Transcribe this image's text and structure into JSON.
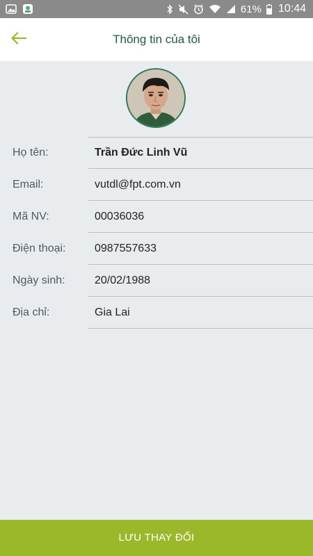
{
  "status_bar": {
    "battery_percent": "61%",
    "time": "10:44",
    "left_icons": [
      "gallery-notification-icon",
      "app-notification-icon"
    ],
    "right_icons": [
      "bluetooth-icon",
      "mute-icon",
      "alarm-icon",
      "wifi-icon",
      "signal-icon",
      "battery-icon"
    ]
  },
  "header": {
    "title": "Thông tin của tôi",
    "back_icon": "arrow-left-icon"
  },
  "profile": {
    "avatar_icon": "avatar"
  },
  "info": {
    "rows": [
      {
        "label": "Họ tên:",
        "value": "Trần Đức Linh Vũ"
      },
      {
        "label": "Email:",
        "value": "vutdl@fpt.com.vn"
      },
      {
        "label": "Mã NV:",
        "value": "00036036"
      },
      {
        "label": "Điện thoại:",
        "value": "0987557633"
      },
      {
        "label": "Ngày sinh:",
        "value": "20/02/1988"
      },
      {
        "label": "Địa chỉ:",
        "value": "Gia Lai"
      }
    ]
  },
  "footer": {
    "save_label": "LƯU THAY ĐỔI"
  },
  "colors": {
    "accent": "#9bb72a",
    "title": "#1f5a3a",
    "background": "#e9ecef"
  }
}
